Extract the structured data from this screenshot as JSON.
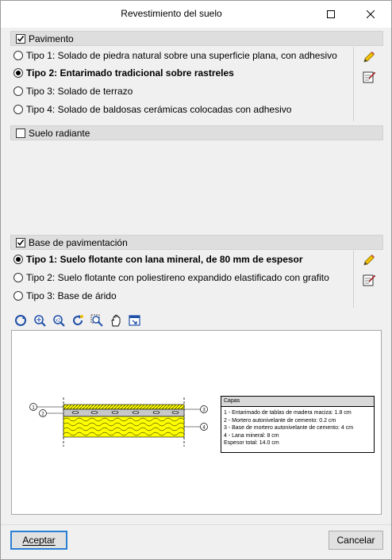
{
  "window": {
    "title": "Revestimiento del suelo"
  },
  "pavimento": {
    "label": "Pavimento",
    "checked": true,
    "options": [
      {
        "label": "Tipo 1: Solado de piedra natural sobre una superficie plana, con adhesivo",
        "selected": false
      },
      {
        "label": "Tipo 2: Entarimado tradicional sobre rastreles",
        "selected": true
      },
      {
        "label": "Tipo 3: Solado de terrazo",
        "selected": false
      },
      {
        "label": "Tipo 4: Solado de baldosas cerámicas colocadas con adhesivo",
        "selected": false
      }
    ]
  },
  "suelo_radiante": {
    "label": "Suelo radiante",
    "checked": false
  },
  "base": {
    "label": "Base de pavimentación",
    "checked": true,
    "options": [
      {
        "label": "Tipo 1: Suelo flotante con lana mineral, de 80 mm de espesor",
        "selected": true
      },
      {
        "label": "Tipo 2: Suelo flotante con poliestireno expandido elastificado con grafito",
        "selected": false
      },
      {
        "label": "Tipo 3: Base de árido",
        "selected": false
      }
    ]
  },
  "toolbar": {
    "icons": [
      "rotate-view-icon",
      "zoom-extents-icon",
      "zoom-2x-icon",
      "refresh-icon",
      "zoom-window-icon",
      "pan-hand-icon",
      "export-icon"
    ]
  },
  "diagram": {
    "legend": {
      "title": "Capas",
      "lines": [
        "1 - Entarimado de tablas de madera maciza: 1.8 cm",
        "2 - Mortero autonivelante de cemento: 0.2 cm",
        "3 - Base de mortero autonivelante de cemento: 4 cm",
        "4 - Lana mineral: 8 cm",
        "Espesor total: 14.0 cm"
      ]
    },
    "markers": [
      "1",
      "2",
      "3",
      "4"
    ],
    "colors": {
      "mineral_wool": "#ffff00",
      "wood": "#ffff00",
      "mortar": "#c8c8c8"
    }
  },
  "buttons": {
    "accept": "Aceptar",
    "cancel": "Cancelar"
  },
  "colors": {
    "accent": "#2a7fd4",
    "header_bg": "#dedede",
    "window_bg": "#f0f0f0"
  }
}
